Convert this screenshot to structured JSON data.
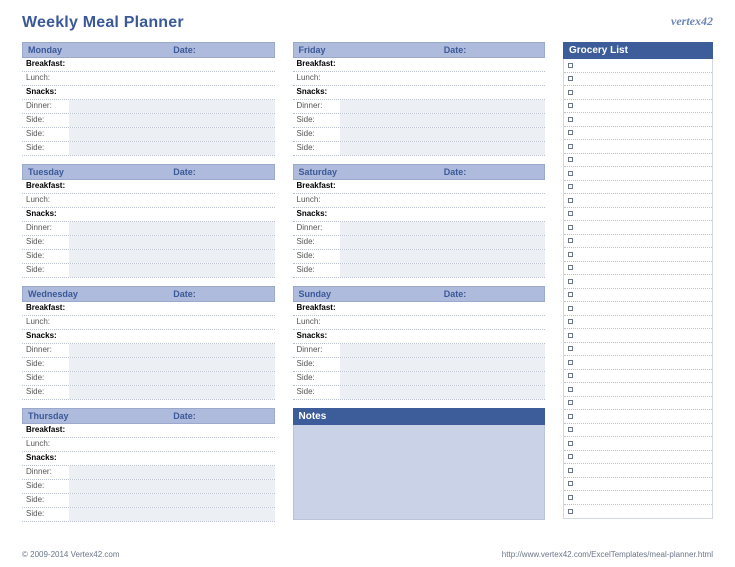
{
  "title": "Weekly Meal Planner",
  "brand": "vertex42",
  "row_labels": {
    "breakfast": "Breakfast:",
    "lunch": "Lunch:",
    "snacks": "Snacks:",
    "dinner": "Dinner:",
    "side": "Side:"
  },
  "date_label": "Date:",
  "days_left": [
    {
      "name": "Monday"
    },
    {
      "name": "Tuesday"
    },
    {
      "name": "Wednesday"
    },
    {
      "name": "Thursday"
    }
  ],
  "days_mid": [
    {
      "name": "Friday"
    },
    {
      "name": "Saturday"
    },
    {
      "name": "Sunday"
    }
  ],
  "notes_heading": "Notes",
  "grocery_heading": "Grocery List",
  "grocery_count": 34,
  "footer": {
    "copyright": "© 2009-2014 Vertex42.com",
    "url": "http://www.vertex42.com/ExcelTemplates/meal-planner.html"
  }
}
